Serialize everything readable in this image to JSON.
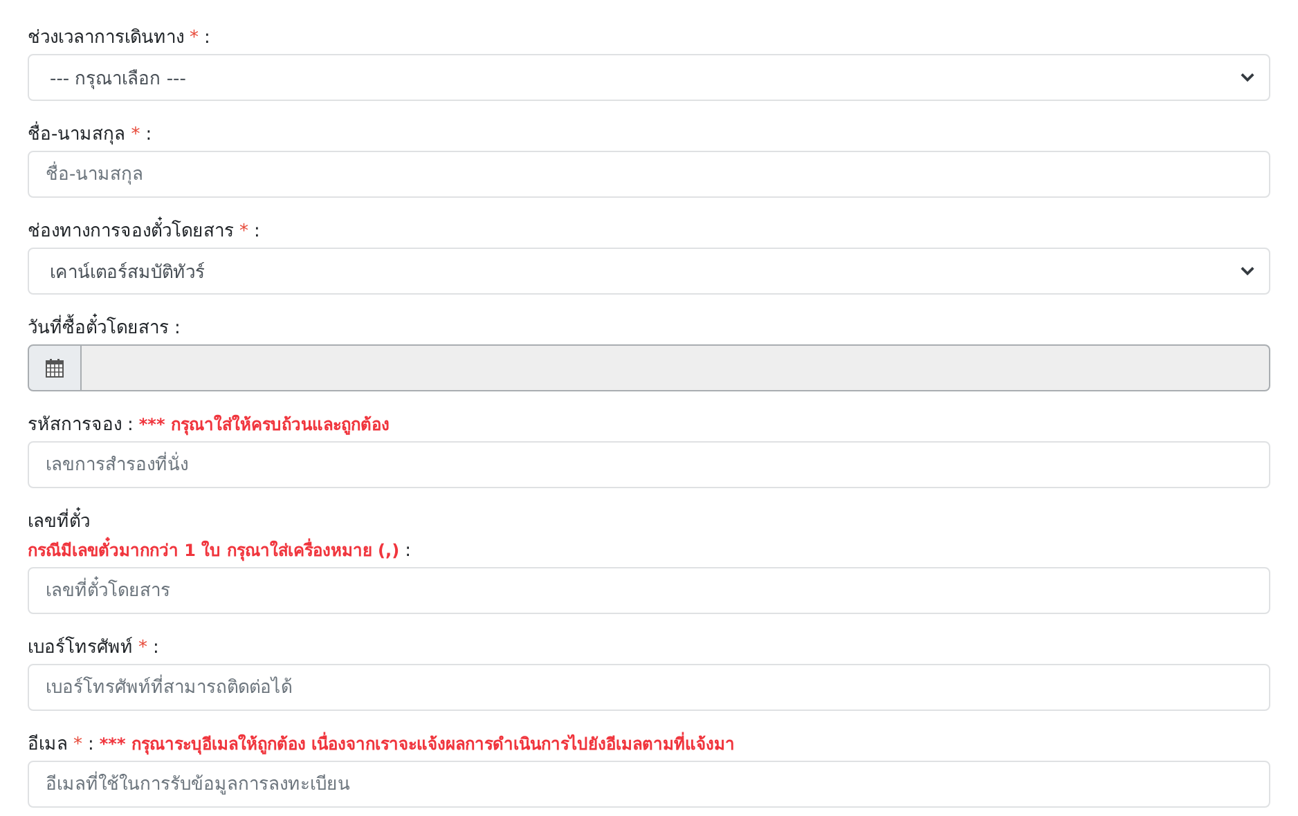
{
  "fields": [
    {
      "kind": "select",
      "label_lines": [
        [
          {
            "kind": "plain",
            "text": "ช่วงเวลาการเดินทาง"
          },
          {
            "kind": "required",
            "text": "*"
          },
          {
            "kind": "plain",
            "text": ":"
          }
        ]
      ],
      "value": "--- กรุณาเลือก ---"
    },
    {
      "kind": "text",
      "label_lines": [
        [
          {
            "kind": "plain",
            "text": "ชื่อ-นามสกุล"
          },
          {
            "kind": "required",
            "text": "*"
          },
          {
            "kind": "plain",
            "text": ":"
          }
        ]
      ],
      "placeholder": "ชื่อ-นามสกุล"
    },
    {
      "kind": "select",
      "label_lines": [
        [
          {
            "kind": "plain",
            "text": "ช่องทางการจองตั๋วโดยสาร"
          },
          {
            "kind": "required",
            "text": "*"
          },
          {
            "kind": "plain",
            "text": ":"
          }
        ]
      ],
      "value": "เคาน์เตอร์สมบัติทัวร์"
    },
    {
      "kind": "date",
      "label_lines": [
        [
          {
            "kind": "plain",
            "text": "วันที่ซื้อตั๋วโดยสาร"
          },
          {
            "kind": "plain",
            "text": ":"
          }
        ]
      ],
      "disabled": true
    },
    {
      "kind": "text",
      "label_lines": [
        [
          {
            "kind": "plain",
            "text": "รหัสการจอง"
          },
          {
            "kind": "plain",
            "text": ":"
          },
          {
            "kind": "note",
            "text": "*** กรุณาใส่ให้ครบถ้วนและถูกต้อง"
          }
        ]
      ],
      "placeholder": "เลขการสำรองที่นั่ง"
    },
    {
      "kind": "text",
      "label_lines": [
        [
          {
            "kind": "plain",
            "text": "เลขที่ตั๋ว"
          }
        ],
        [
          {
            "kind": "note",
            "text": "กรณีมีเลขตั๋วมากกว่า 1 ใบ กรุณาใส่เครื่องหมาย (,)"
          },
          {
            "kind": "plain",
            "text": ":"
          }
        ]
      ],
      "placeholder": "เลขที่ตั๋วโดยสาร"
    },
    {
      "kind": "text",
      "label_lines": [
        [
          {
            "kind": "plain",
            "text": "เบอร์โทรศัพท์"
          },
          {
            "kind": "required",
            "text": "*"
          },
          {
            "kind": "plain",
            "text": ":"
          }
        ]
      ],
      "placeholder": "เบอร์โทรศัพท์ที่สามารถติดต่อได้"
    },
    {
      "kind": "text",
      "label_lines": [
        [
          {
            "kind": "plain",
            "text": "อีเมล"
          },
          {
            "kind": "required",
            "text": "*"
          },
          {
            "kind": "plain",
            "text": ":"
          },
          {
            "kind": "note",
            "text": "*** กรุณาระบุอีเมลให้ถูกต้อง เนื่องจากเราจะแจ้งผลการดำเนินการไปยังอีเมลตามที่แจ้งมา"
          }
        ]
      ],
      "placeholder": "อีเมลที่ใช้ในการรับข้อมูลการลงทะเบียน"
    }
  ]
}
